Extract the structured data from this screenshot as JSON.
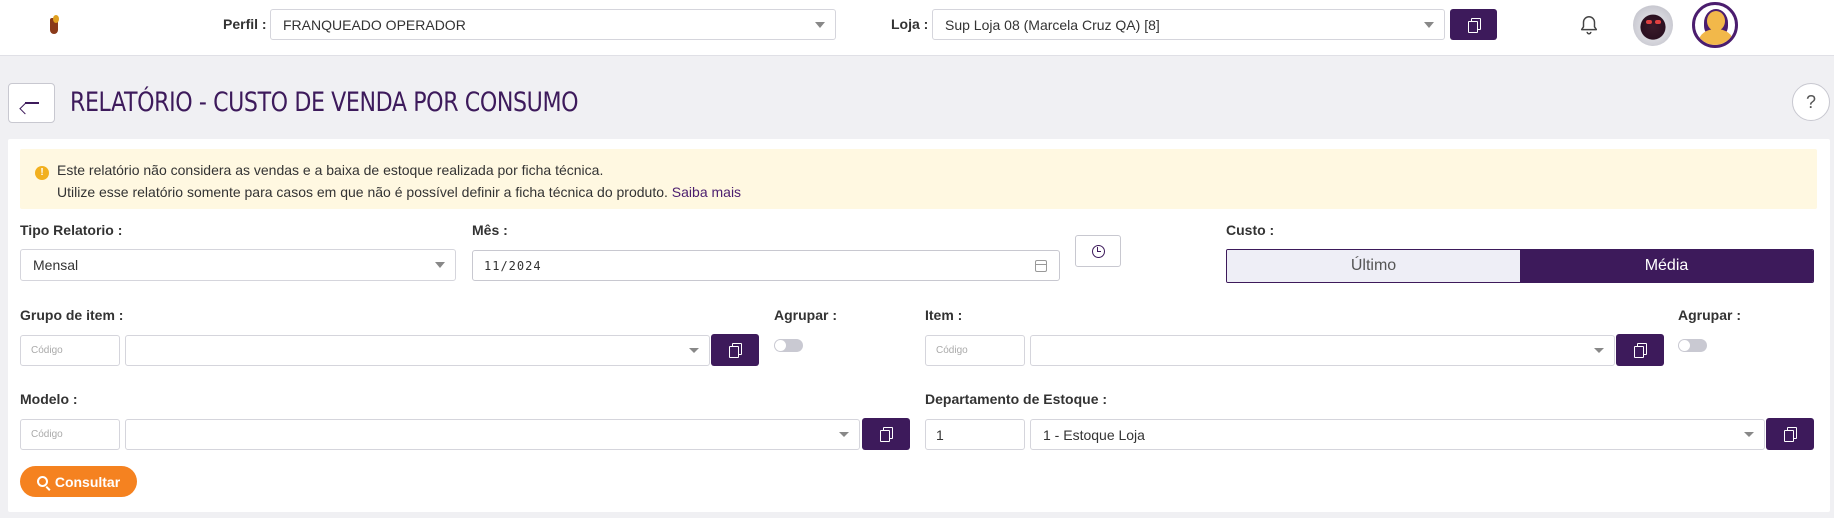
{
  "topbar": {
    "profile_label": "Perfil :",
    "profile_value": "FRANQUEADO OPERADOR",
    "store_label": "Loja :",
    "store_value": "Sup Loja 08 (Marcela Cruz QA) [8]"
  },
  "page": {
    "title": "RELATÓRIO - CUSTO DE VENDA POR CONSUMO",
    "help_label": "?"
  },
  "alert": {
    "line1": "Este relatório não considera as vendas e a baixa de estoque realizada por ficha técnica.",
    "line2": "Utilize esse relatório somente para casos em que não é possível definir a ficha técnica do produto.",
    "link": "Saiba mais",
    "icon": "!"
  },
  "form": {
    "report_type_label": "Tipo Relatorio :",
    "report_type_value": "Mensal",
    "month_label": "Mês :",
    "month_value": "11/2024",
    "cost_label": "Custo :",
    "cost_options": [
      "Último",
      "Média"
    ],
    "cost_selected": "Média",
    "item_group_label": "Grupo de item :",
    "code_placeholder": "Código",
    "group_by_label": "Agrupar :",
    "item_label": "Item :",
    "model_label": "Modelo :",
    "stock_dept_label": "Departamento de Estoque :",
    "stock_dept_code": "1",
    "stock_dept_value": "1 - Estoque Loja",
    "submit_label": "Consultar"
  },
  "colors": {
    "primary": "#3d1a5b",
    "accent": "#f58220",
    "alert_bg": "#fff8e1"
  }
}
